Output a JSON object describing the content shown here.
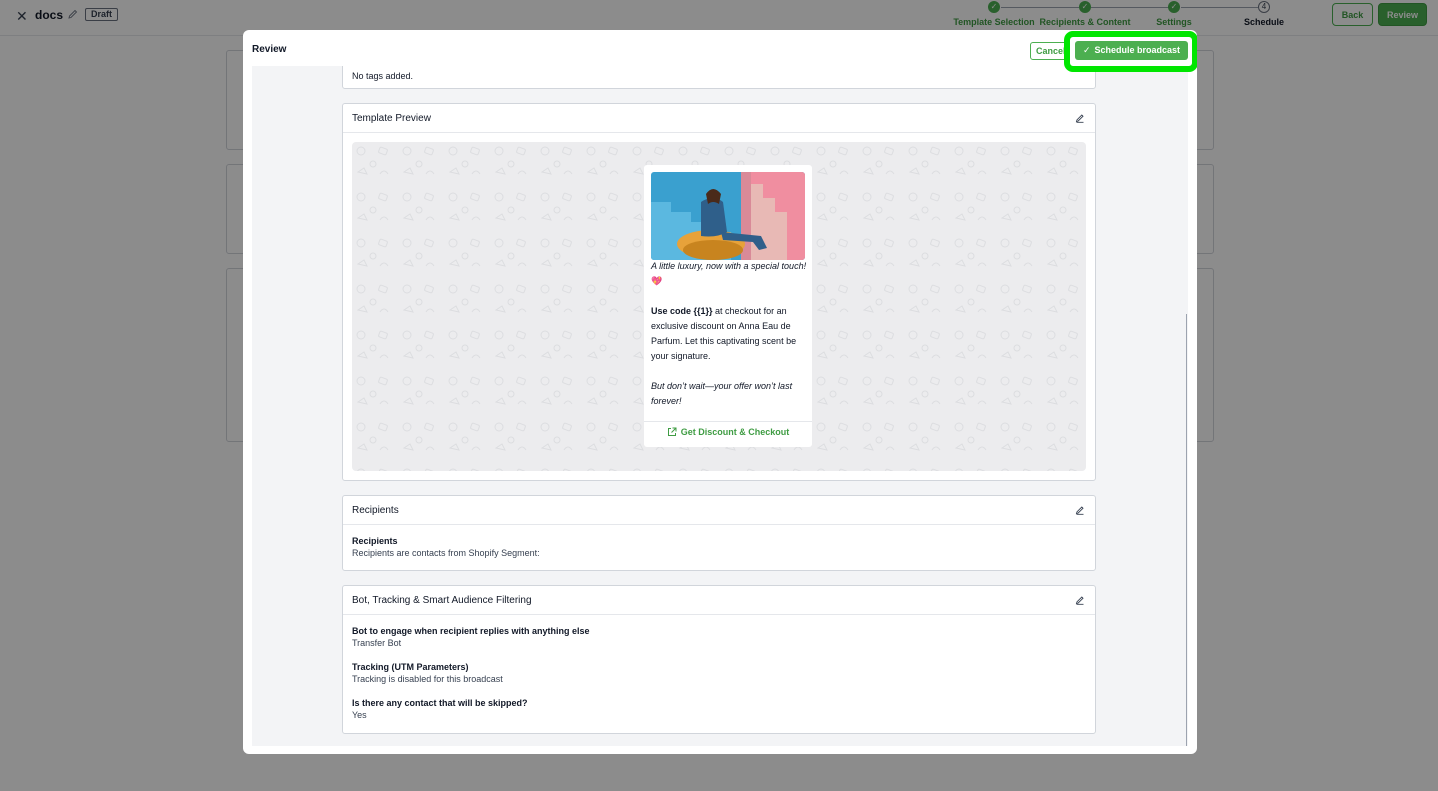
{
  "topbar": {
    "close_icon": "close-icon",
    "doc_title": "docs",
    "draft_badge": "Draft",
    "back_label": "Back",
    "review_label": "Review"
  },
  "stepper": {
    "steps": [
      {
        "label": "Template Selection",
        "state": "done",
        "number": "1"
      },
      {
        "label": "Recipients & Content",
        "state": "done",
        "number": "2"
      },
      {
        "label": "Settings",
        "state": "done",
        "number": "3"
      },
      {
        "label": "Schedule",
        "state": "current",
        "number": "4"
      }
    ]
  },
  "colors": {
    "accent": "#4caf50",
    "accent_text": "#3f9c43",
    "highlight": "#00e600"
  },
  "modal": {
    "title": "Review",
    "cancel_label": "Cancel",
    "schedule_label": "Schedule broadcast",
    "tags_text": "No tags added.",
    "template_preview": {
      "title": "Template Preview",
      "line1": "A little luxury, now with a special touch!",
      "emoji": "💖",
      "code_bold": "Use code {{1}}",
      "code_rest": " at checkout for an exclusive discount on Anna Eau de Parfum. Let this captivating scent be your signature.",
      "line3": "But don’t wait—your offer won’t last forever!",
      "cta_label": "Get Discount & Checkout"
    },
    "recipients": {
      "title": "Recipients",
      "label": "Recipients",
      "value": "Recipients are contacts from Shopify Segment:"
    },
    "bot": {
      "title": "Bot, Tracking & Smart Audience Filtering",
      "fields": [
        {
          "label": "Bot to engage when recipient replies with anything else",
          "value": "Transfer Bot"
        },
        {
          "label": "Tracking (UTM Parameters)",
          "value": "Tracking is disabled for this broadcast"
        },
        {
          "label": "Is there any contact that will be skipped?",
          "value": "Yes"
        }
      ]
    }
  }
}
